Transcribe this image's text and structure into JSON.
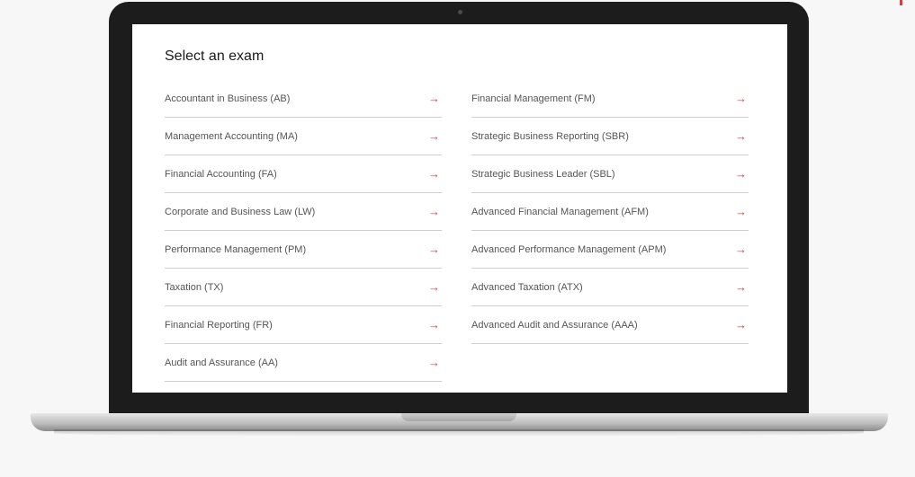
{
  "page": {
    "title": "Select an exam"
  },
  "arrow_glyph": "→",
  "colors": {
    "accent": "#e03a3a",
    "divider": "#cfcfcf",
    "text": "#555555"
  },
  "exams": {
    "left": [
      "Accountant in Business (AB)",
      "Management Accounting (MA)",
      "Financial Accounting (FA)",
      "Corporate and Business Law (LW)",
      "Performance Management (PM)",
      "Taxation (TX)",
      "Financial Reporting (FR)",
      "Audit and Assurance (AA)"
    ],
    "right": [
      "Financial Management (FM)",
      "Strategic Business Reporting (SBR)",
      "Strategic Business Leader (SBL)",
      "Advanced Financial Management (AFM)",
      "Advanced Performance Management (APM)",
      "Advanced Taxation (ATX)",
      "Advanced Audit and Assurance (AAA)"
    ]
  }
}
